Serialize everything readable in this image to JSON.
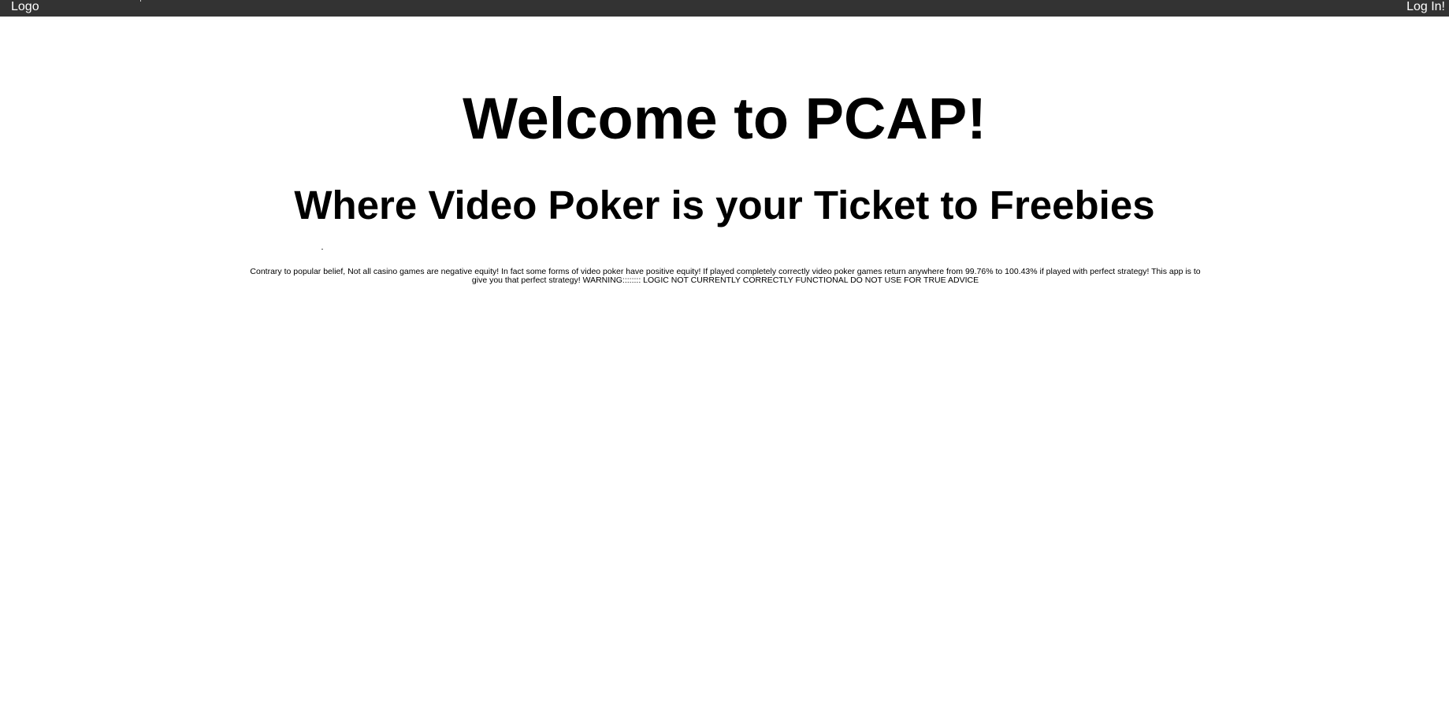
{
  "nav": {
    "logo_label": "Logo",
    "login_label": "Log In!"
  },
  "hero": {
    "title": "Welcome to PCAP!",
    "subtitle": "Where Video Poker is your Ticket to Freebies",
    "dot": ".",
    "description": "Contrary to popular belief, Not all casino games are negative equity! In fact some forms of video poker have positive equity! If played completely correctly video poker games return anywhere from 99.76% to 100.43% if played with perfect strategy! This app is to give you that perfect strategy! WARNING:::::::: LOGIC NOT CURRENTLY CORRECTLY FUNCTIONAL DO NOT USE FOR TRUE ADVICE"
  },
  "colors": {
    "topbar_background": "#333333",
    "topbar_text": "#ffffff",
    "page_background": "#ffffff",
    "text": "#000000"
  }
}
